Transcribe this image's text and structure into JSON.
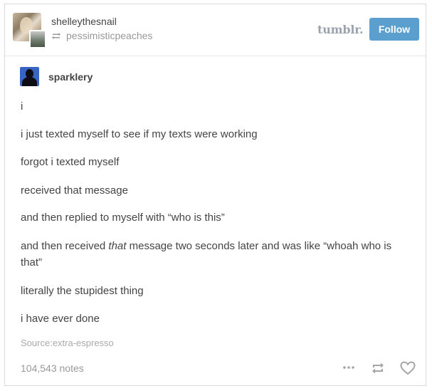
{
  "header": {
    "blog_name": "shelleythesnail",
    "reblogged_from": "pessimisticpeaches",
    "logo_text": "tumblr.",
    "follow_label": "Follow"
  },
  "post": {
    "source_blog": "sparklery",
    "lines": [
      "i",
      "i just texted myself to see if my texts were working",
      "forgot i texted myself",
      "received that message",
      "and then replied to myself with “who is this”",
      "and then received ",
      "that",
      " message two seconds later and was like “whoah who is",
      "that”",
      "literally the stupidest thing",
      "i have ever done"
    ],
    "source_label": "Source:",
    "source_name": "extra-espresso"
  },
  "footer": {
    "notes": "104,543 notes",
    "more_icon": "ellipsis-icon",
    "reblog_icon": "reblog-icon",
    "like_icon": "heart-icon"
  },
  "colors": {
    "follow_button": "#5b9fcf",
    "avatar_blue": "#3a64c4",
    "muted_text": "#999999",
    "body_text": "#444444"
  }
}
